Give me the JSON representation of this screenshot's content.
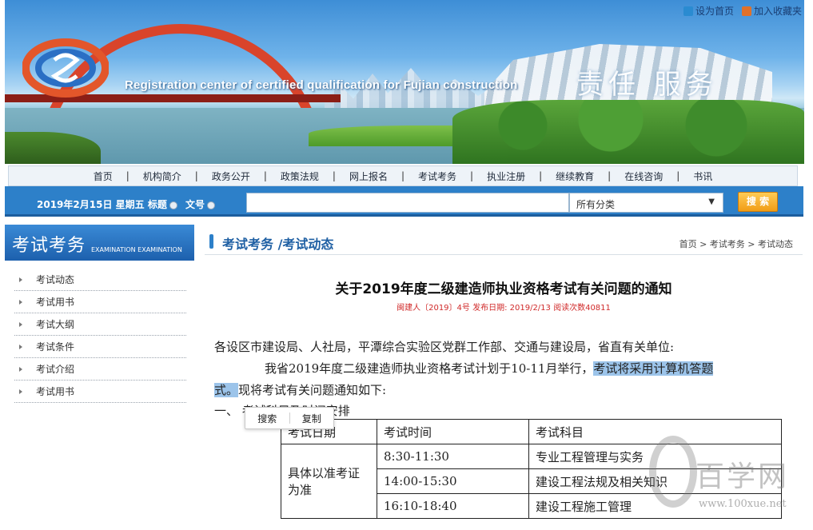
{
  "header": {
    "en_title": "Registration center of certified qualification for Fujian construction",
    "slogan": "责任  服务",
    "top_links": {
      "set_home": "设为首页",
      "add_favorite": "加入收藏夹"
    }
  },
  "nav": {
    "items": [
      "首页",
      "机构简介",
      "政务公开",
      "政策法规",
      "网上报名",
      "考试考务",
      "执业注册",
      "继续教育",
      "在线咨询",
      "书讯"
    ]
  },
  "search": {
    "date": "2019年2月15日 星期五",
    "radio_title": "标题",
    "radio_docno": "文号",
    "input_value": "",
    "category": "所有分类",
    "button": "搜 索"
  },
  "sidebar": {
    "title": "考试考务",
    "title_en": "EXAMINATION EXAMINATION",
    "items": [
      "考试动态",
      "考试用书",
      "考试大纲",
      "考试条件",
      "考试介绍",
      "考试用书"
    ]
  },
  "main": {
    "section": "考试考务 /考试动态",
    "breadcrumb": "首页 > 考试考务 > 考试动态",
    "title": "关于2019年度二级建造师执业资格考试有关问题的通知",
    "meta": "闽建人〔2019〕4号   发布日期: 2019/2/13    阅读次数40811",
    "salutation": "各设区市建设局、人社局，平潭综合实验区党群工作部、交通与建设局，省直有关单位:",
    "para1_a": "我省2019年度二级建造师执业资格考试计划于10-11月举行，",
    "para1_hl": "考试将采用计算机答题",
    "para2_hl": "式。",
    "para2_rest": "现将考试有关问题通知如下:",
    "section_one": "一、 考试科目及时间安排",
    "popup": {
      "search": "搜索",
      "copy": "复制"
    },
    "table": {
      "headers": [
        "考试日期",
        "考试时间",
        "考试科目"
      ],
      "merged_date": "具体以准考证为准",
      "rows": [
        {
          "time": "8:30-11:30",
          "subject": "专业工程管理与实务"
        },
        {
          "time": "14:00-15:30",
          "subject": "建设工程法规及相关知识"
        },
        {
          "time": "16:10-18:40",
          "subject": "建设工程施工管理"
        }
      ]
    }
  },
  "watermark": {
    "text": "百学网",
    "url": "www.100xue.net"
  }
}
